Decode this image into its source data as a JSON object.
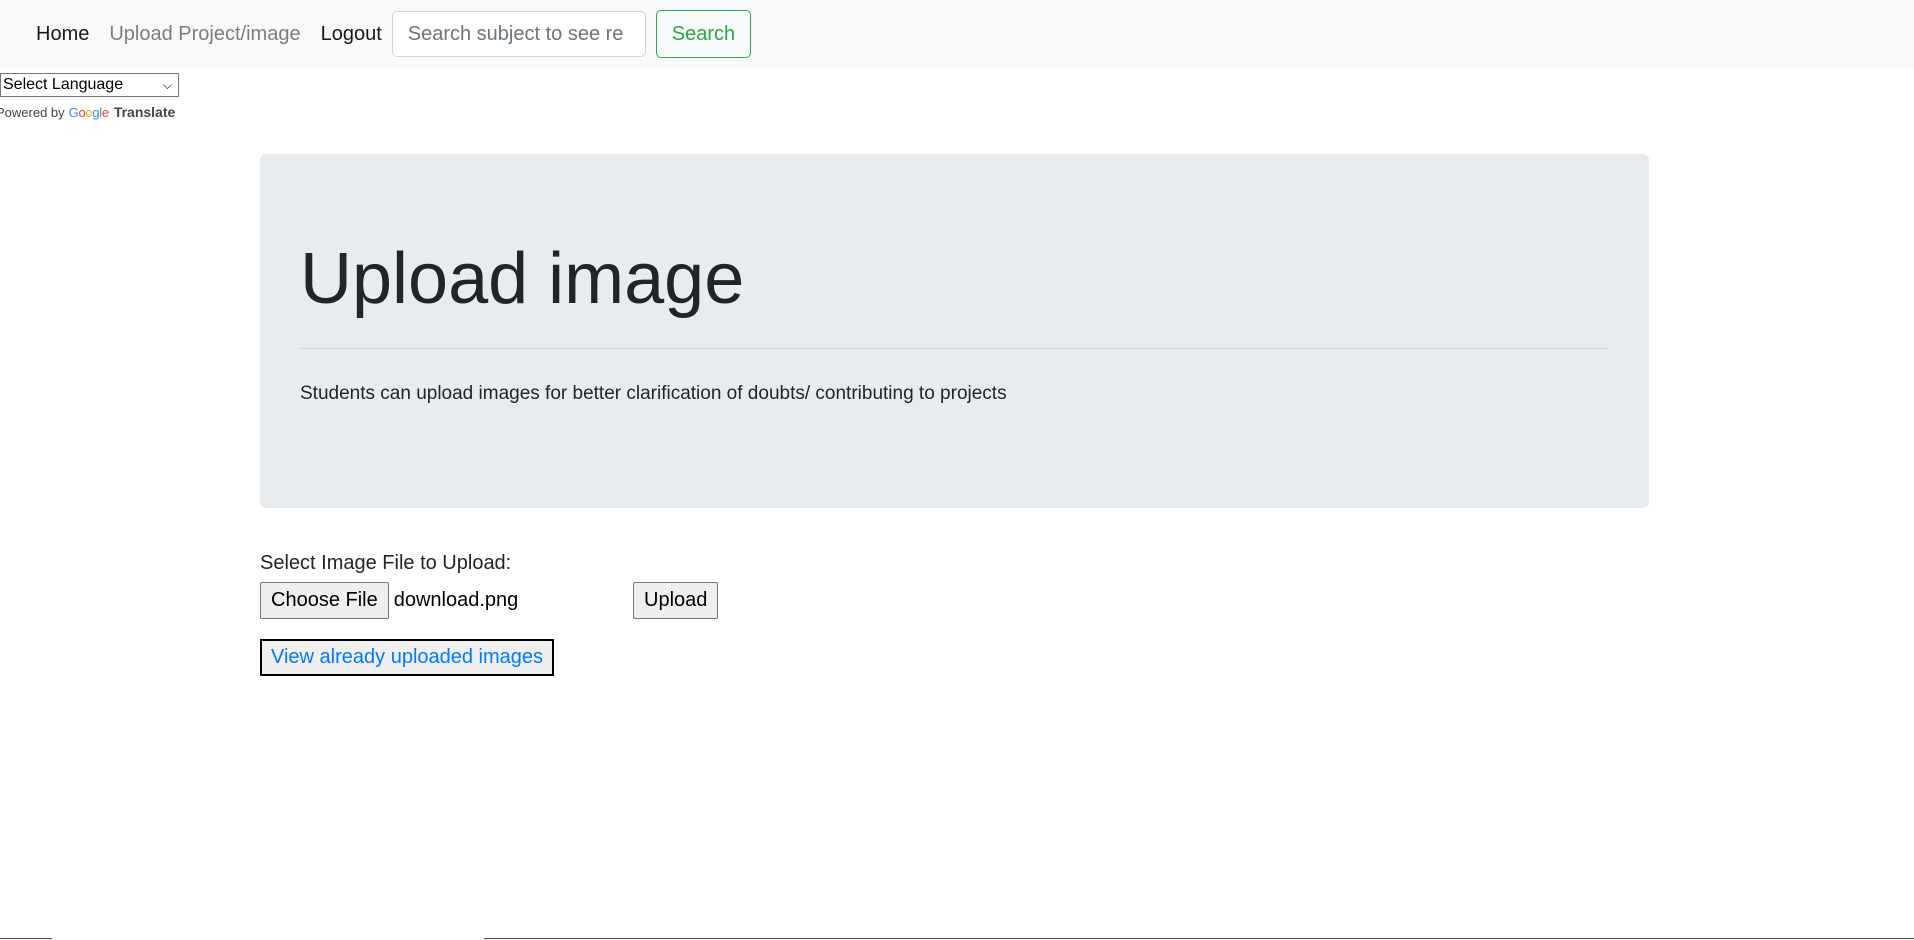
{
  "nav": {
    "home_label": "Home",
    "upload_label": "Upload Project/image",
    "logout_label": "Logout",
    "search_placeholder": "Search subject to see re",
    "search_button_label": "Search"
  },
  "translate": {
    "select_label": "Select Language",
    "powered_by": "Powered by",
    "google_logo_text": "Google",
    "translate_label": "Translate"
  },
  "jumbotron": {
    "title": "Upload image",
    "lead": "Students can upload images for better clarification of doubts/ contributing to projects"
  },
  "upload_form": {
    "label": "Select Image File to Upload:",
    "choose_file_label": "Choose File",
    "selected_file": "download.png",
    "upload_button_label": "Upload",
    "view_uploaded_label": "View already uploaded images"
  },
  "colors": {
    "navbar_bg": "#f8f9fa",
    "jumbotron_bg": "#e9ecef",
    "search_button": "#28a745",
    "link": "#007bff"
  }
}
